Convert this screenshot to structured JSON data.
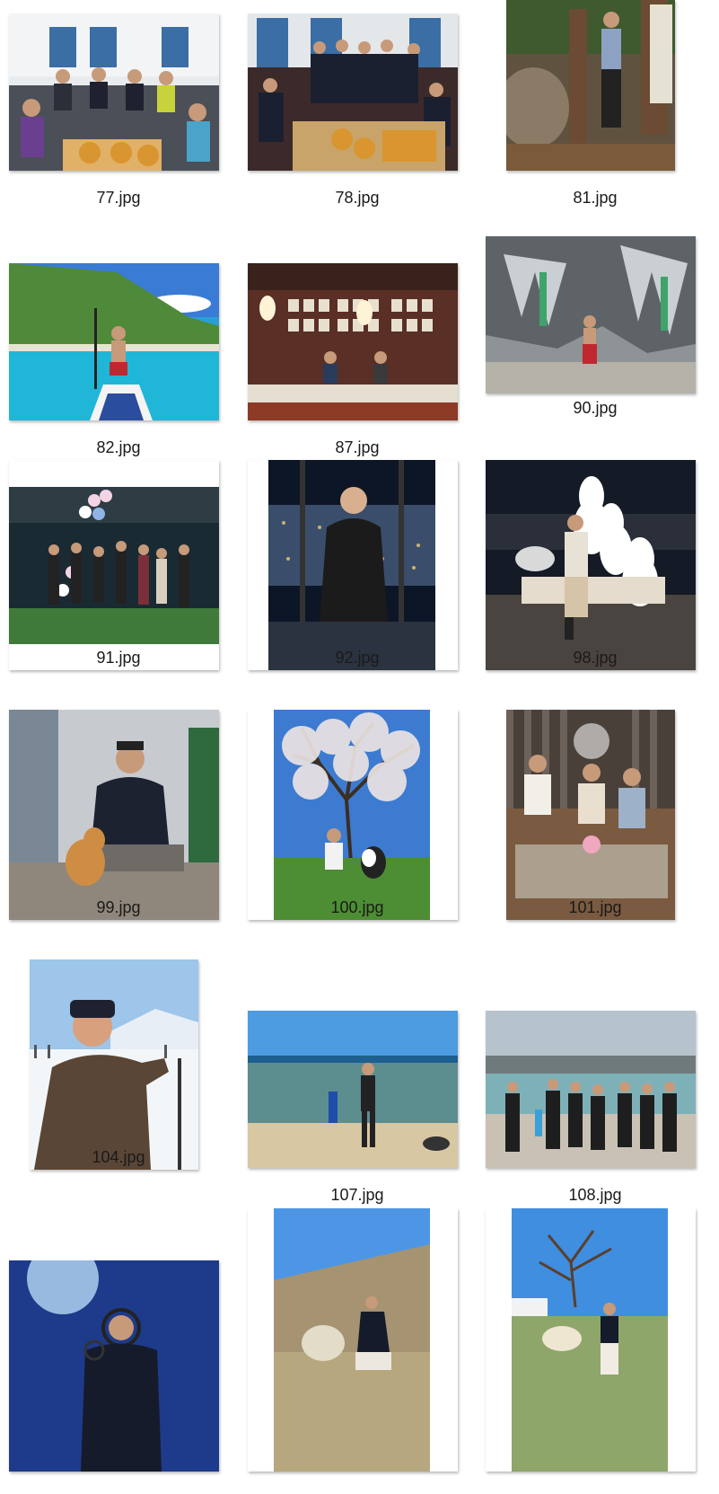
{
  "files": [
    {
      "name": "77.jpg",
      "scene": "group-photo-with-pizza"
    },
    {
      "name": "78.jpg",
      "scene": "police-team-with-pizza"
    },
    {
      "name": "81.jpg",
      "scene": "hiker-at-trail-sign"
    },
    {
      "name": "82.jpg",
      "scene": "paddleboard-on-sea"
    },
    {
      "name": "87.jpg",
      "scene": "tea-shop-interior"
    },
    {
      "name": "90.jpg",
      "scene": "man-at-cave-wall"
    },
    {
      "name": "91.jpg",
      "scene": "family-with-balloons-at-night"
    },
    {
      "name": "92.jpg",
      "scene": "man-at-city-window-at-night"
    },
    {
      "name": "98.jpg",
      "scene": "man-with-samoyed-statues"
    },
    {
      "name": "99.jpg",
      "scene": "man-with-shiba-dog"
    },
    {
      "name": "100.jpg",
      "scene": "man-with-dog-under-tree"
    },
    {
      "name": "101.jpg",
      "scene": "three-friends-on-sofa"
    },
    {
      "name": "104.jpg",
      "scene": "ski-selfie"
    },
    {
      "name": "107.jpg",
      "scene": "diver-on-beach"
    },
    {
      "name": "108.jpg",
      "scene": "divers-group-on-rocks"
    },
    {
      "name": "",
      "scene": "underwater-diver"
    },
    {
      "name": "",
      "scene": "man-with-sheep-on-hill"
    },
    {
      "name": "",
      "scene": "man-with-alpaca-under-tree"
    }
  ]
}
